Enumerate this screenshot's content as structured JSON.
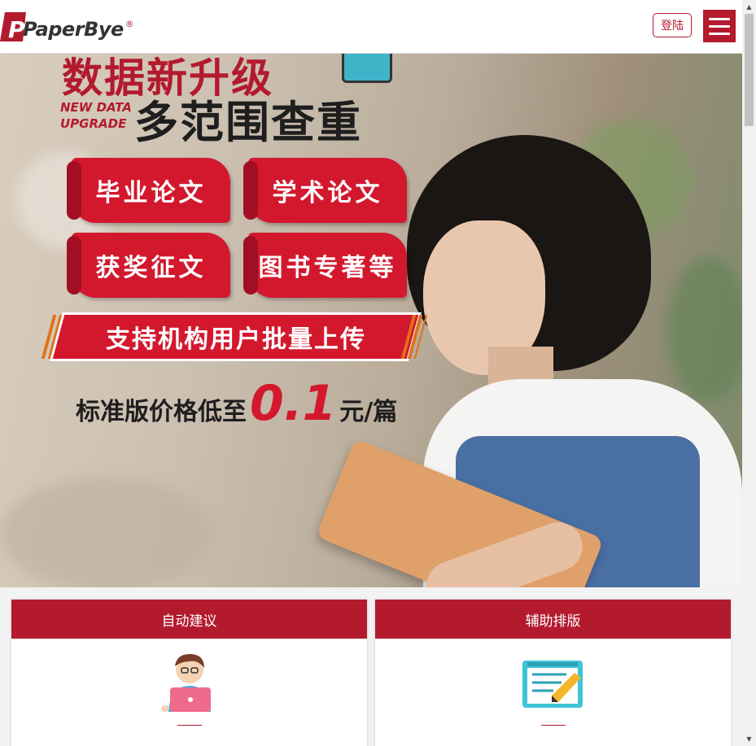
{
  "header": {
    "logo_text": "PaperBye",
    "logo_reg": "®",
    "login_label": "登陆",
    "menu_icon": "hamburger-icon"
  },
  "banner": {
    "title_top": "数据新升级",
    "subtitle_en_1": "NEW DATA",
    "subtitle_en_2": "UPGRADE",
    "title_main": "多范围查重",
    "tags": [
      "毕业论文",
      "学术论文",
      "获奖征文",
      "图书专著等"
    ],
    "ribbon": "支持机构用户批量上传",
    "price_prefix": "标准版价格低至",
    "price_value": "0.1",
    "price_unit": "元/篇"
  },
  "features": [
    {
      "title": "自动建议",
      "icon": "user-laptop-icon",
      "desc": ""
    },
    {
      "title": "辅助排版",
      "icon": "edit-document-icon",
      "desc": ""
    }
  ],
  "colors": {
    "brand": "#b31a2e",
    "accent": "#d3182e"
  }
}
